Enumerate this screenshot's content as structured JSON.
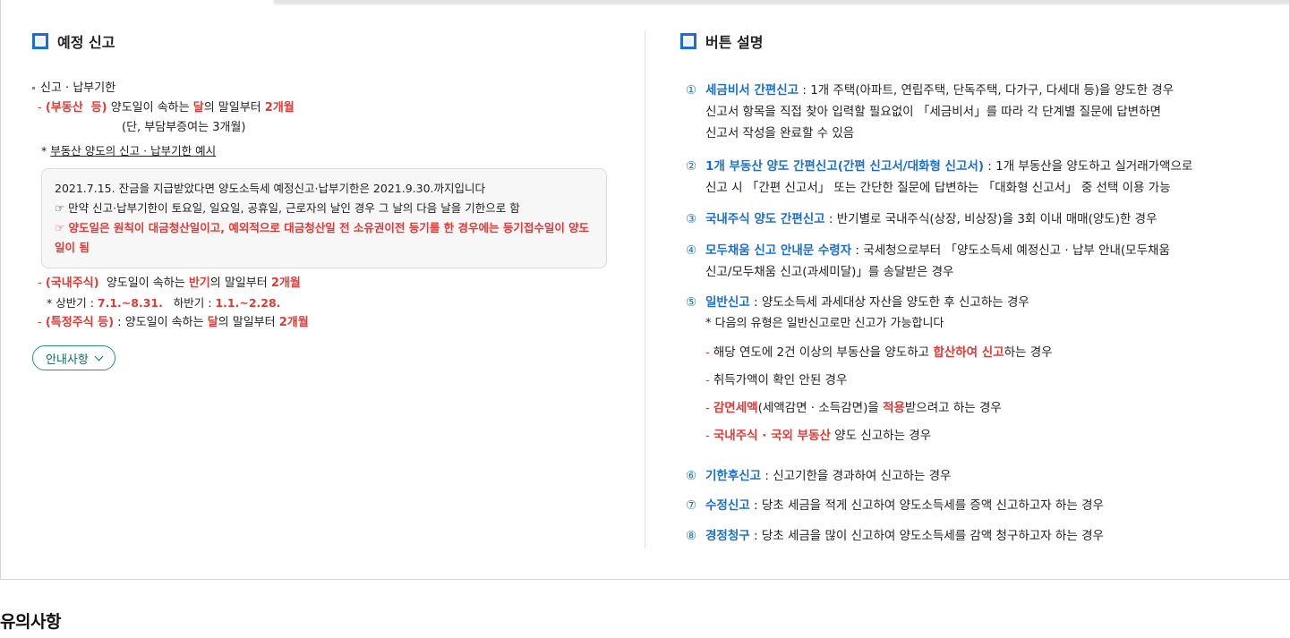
{
  "left_section": {
    "title": "예정 신고",
    "deadline_header": "신고 · 납부기한",
    "realestate": {
      "label": "(부동산  등)",
      "text_a": " 양도일이 속하는 ",
      "highlight": "달",
      "text_b": "의 말일부터 ",
      "period": "2개월",
      "note": "(단, 부담부증여는 3개월)"
    },
    "example_title": "부동산 양도의 신고 · 납부기한 예시",
    "example_box": {
      "line1": "2021.7.15. 잔금을 지급받았다면 양도소득세 예정신고·납부기한은 2021.9.30.까지입니다",
      "line2": "☞ 만약 신고·납부기한이 토요일, 일요일, 공휴일, 근로자의 날인 경우 그 날의 다음 날을 기한으로 함",
      "line3": "☞ 양도일은 원칙이 대금청산일이고, 예외적으로 대금청산일 전 소유권이전 등기를 한 경우에는 등기접수일이 양도일이 됨"
    },
    "domestic_stock": {
      "label": "(국내주식)",
      "text_a": "  양도일이 속하는 ",
      "highlight": "반기",
      "text_b": "의 말일부터 ",
      "period": "2개월",
      "first_half_label": "* 상반기 : ",
      "first_half": "7.1.~8.31.",
      "second_half_label": "하반기 : ",
      "second_half": "1.1.~2.28."
    },
    "specific_stock": {
      "label": "(특정주식 등)",
      "text_a": " : 양도일이 속하는 ",
      "highlight": "달",
      "text_b": "의 말일부터 ",
      "period": "2개월"
    },
    "guide_button": "안내사항"
  },
  "right_section": {
    "title": "버튼 설명",
    "items": [
      {
        "num": "①",
        "label": "세금비서 간편신고",
        "lines": [
          " : 1개 주택(아파트, 연립주택, 단독주택, 다가구, 다세대 등)을 양도한 경우",
          "신고서 항목을 직접 찾아 입력할 필요없이 「세금비서」를 따라 각 단계별 질문에 답변하면",
          "신고서 작성을 완료할 수 있음"
        ]
      },
      {
        "num": "②",
        "label": "1개 부동산 양도 간편신고(간편 신고서/대화형 신고서)",
        "lines": [
          " : 1개 부동산을 양도하고 실거래가액으로",
          "신고 시 「간편 신고서」 또는 간단한 질문에 답변하는 「대화형 신고서」 중 선택 이용 가능"
        ]
      },
      {
        "num": "③",
        "label": "국내주식 양도 간편신고",
        "lines": [
          " : 반기별로 국내주식(상장, 비상장)을 3회 이내 매매(양도)한 경우"
        ]
      },
      {
        "num": "④",
        "label": "모두채움 신고 안내문 수령자",
        "lines": [
          " : 국세청으로부터 「양도소득세 예정신고 · 납부 안내(모두채움",
          "신고/모두채움 신고(과세미달)」를 송달받은 경우"
        ]
      },
      {
        "num": "⑤",
        "label": "일반신고",
        "lines": [
          " : 양도소득세 과세대상 자산을 양도한 후 신고하는 경우",
          "* 다음의 유형은 일반신고로만 신고가 가능합니다"
        ]
      },
      {
        "num": "⑥",
        "label": "기한후신고",
        "lines": [
          " : 신고기한을 경과하여 신고하는 경우"
        ]
      },
      {
        "num": "⑦",
        "label": "수정신고",
        "lines": [
          " : 당초 세금을 적게 신고하여 양도소득세를 증액 신고하고자 하는 경우"
        ]
      },
      {
        "num": "⑧",
        "label": "경정청구",
        "lines": [
          " : 당초 세금을 많이 신고하여 양도소득세를 감액 청구하고자 하는 경우"
        ]
      }
    ],
    "general_cases": {
      "case1_a": "해당 연도에 2건 이상의 부동산을 양도하고 ",
      "case1_red": "합산하여 신고",
      "case1_b": "하는 경우",
      "case2": "취득가액이 확인 안된 경우",
      "case3_red1": "감면세액",
      "case3_a": "(세액감면 · 소득감면)을 ",
      "case3_red2": "적용",
      "case3_b": "받으려고 하는 경우",
      "case4_red": "국내주식 · 국외 부동산",
      "case4_a": " 양도 신고하는 경우"
    }
  },
  "bottom": {
    "title": "유의사항"
  }
}
